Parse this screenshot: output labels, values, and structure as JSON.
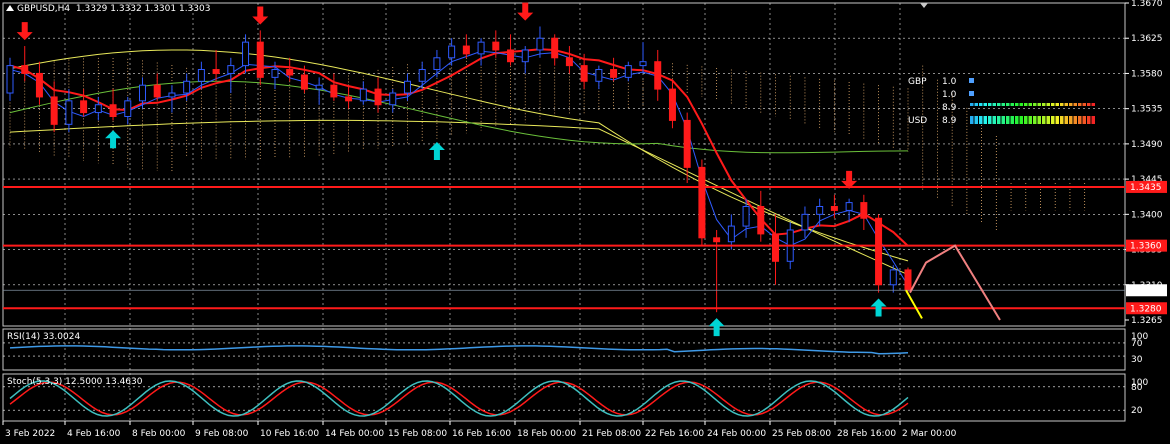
{
  "header": {
    "symbol": "GBPUSD,H4",
    "ohlc": "1.3329 1.3332 1.3301 1.3303"
  },
  "price_axis": {
    "ticks": [
      "1.3670",
      "1.3625",
      "1.3580",
      "1.3535",
      "1.3490",
      "1.3445",
      "1.3400",
      "1.3355",
      "1.3310",
      "1.3265"
    ],
    "ymax": 1.367,
    "ymin": 1.3265
  },
  "levels": [
    {
      "price": 1.3435,
      "label": "1.3435",
      "color": "#ff1a1a"
    },
    {
      "price": 1.336,
      "label": "1.3360",
      "color": "#ff1a1a"
    },
    {
      "price": 1.328,
      "label": "1.3280",
      "color": "#ff1a1a"
    }
  ],
  "current_price": {
    "price": 1.3303,
    "label": "1.3303"
  },
  "time_axis": [
    "3 Feb 2022",
    "4 Feb 16:00",
    "8 Feb 00:00",
    "9 Feb 08:00",
    "10 Feb 16:00",
    "14 Feb 00:00",
    "15 Feb 08:00",
    "16 Feb 16:00",
    "18 Feb 00:00",
    "21 Feb 08:00",
    "22 Feb 16:00",
    "24 Feb 00:00",
    "25 Feb 08:00",
    "28 Feb 16:00",
    "2 Mar 00:00"
  ],
  "strength_panel": {
    "rows": [
      {
        "name": "GBP",
        "value": "1.0",
        "value_color": "#ffa500",
        "name_color": "#00ff00"
      },
      {
        "name": "",
        "value": "1.0",
        "value_color": "#4fa0ff",
        "name_color": "#00ff00"
      },
      {
        "name": "",
        "value": "8.9",
        "value_color": "#ffa500",
        "name_color": "#00ff00"
      },
      {
        "name": "USD",
        "value": "8.9",
        "value_color": "#4fa0ff",
        "name_color": "#00ff00"
      }
    ]
  },
  "rsi": {
    "label": "RSI(14) 33.0024",
    "levels": [
      "70",
      "30"
    ],
    "scale_top": "100",
    "scale_bottom": "0"
  },
  "stoch": {
    "label": "Stoch(5,3,3) 12.5000 13.4630",
    "levels": [
      "80",
      "20"
    ],
    "scale_top": "100",
    "scale_bottom": "0"
  },
  "colors": {
    "bull": "#2f5bff",
    "bear": "#ff1a1a",
    "grid": "#ffffff",
    "level": "#ff1a1a",
    "arrow_up": "#00d4d4",
    "arrow_down": "#ff1a1a",
    "ma_fast": "#ff1a1a",
    "ma_slow": "#e8e85a",
    "ma_green": "#6abf3a",
    "rsi_line": "#3f9ae8",
    "stoch_main": "#3fbfbf",
    "stoch_signal": "#ff1a1a"
  },
  "chart_data": {
    "type": "candlestick",
    "title": "GBPUSD,H4",
    "ylim": [
      1.3265,
      1.367
    ],
    "candles": [
      [
        1.3555,
        1.36,
        1.3545,
        1.359
      ],
      [
        1.359,
        1.3615,
        1.357,
        1.358
      ],
      [
        1.358,
        1.3595,
        1.354,
        1.355
      ],
      [
        1.355,
        1.357,
        1.3505,
        1.3515
      ],
      [
        1.3515,
        1.356,
        1.3505,
        1.3545
      ],
      [
        1.3545,
        1.356,
        1.3525,
        1.353
      ],
      [
        1.353,
        1.355,
        1.352,
        1.354
      ],
      [
        1.354,
        1.356,
        1.352,
        1.3525
      ],
      [
        1.3525,
        1.355,
        1.3515,
        1.3545
      ],
      [
        1.3545,
        1.3575,
        1.3535,
        1.3565
      ],
      [
        1.3565,
        1.358,
        1.3545,
        1.355
      ],
      [
        1.355,
        1.3565,
        1.353,
        1.3555
      ],
      [
        1.3555,
        1.358,
        1.3545,
        1.357
      ],
      [
        1.357,
        1.3595,
        1.356,
        1.3585
      ],
      [
        1.3585,
        1.361,
        1.357,
        1.358
      ],
      [
        1.358,
        1.36,
        1.3555,
        1.359
      ],
      [
        1.359,
        1.363,
        1.358,
        1.362
      ],
      [
        1.362,
        1.3635,
        1.3565,
        1.3575
      ],
      [
        1.3575,
        1.3595,
        1.356,
        1.3585
      ],
      [
        1.3585,
        1.36,
        1.357,
        1.3578
      ],
      [
        1.3578,
        1.359,
        1.3555,
        1.356
      ],
      [
        1.356,
        1.3575,
        1.354,
        1.3565
      ],
      [
        1.3565,
        1.358,
        1.3545,
        1.355
      ],
      [
        1.355,
        1.3565,
        1.3535,
        1.3545
      ],
      [
        1.3545,
        1.357,
        1.354,
        1.356
      ],
      [
        1.356,
        1.3575,
        1.353,
        1.354
      ],
      [
        1.354,
        1.356,
        1.353,
        1.3555
      ],
      [
        1.3555,
        1.358,
        1.3545,
        1.357
      ],
      [
        1.357,
        1.3595,
        1.356,
        1.3585
      ],
      [
        1.3585,
        1.361,
        1.3575,
        1.36
      ],
      [
        1.36,
        1.3625,
        1.359,
        1.3615
      ],
      [
        1.3615,
        1.363,
        1.36,
        1.3605
      ],
      [
        1.3605,
        1.3625,
        1.359,
        1.362
      ],
      [
        1.362,
        1.3635,
        1.36,
        1.361
      ],
      [
        1.361,
        1.363,
        1.359,
        1.3595
      ],
      [
        1.3595,
        1.3615,
        1.358,
        1.361
      ],
      [
        1.361,
        1.364,
        1.36,
        1.3625
      ],
      [
        1.3625,
        1.363,
        1.359,
        1.36
      ],
      [
        1.36,
        1.3615,
        1.358,
        1.359
      ],
      [
        1.359,
        1.3605,
        1.356,
        1.357
      ],
      [
        1.357,
        1.359,
        1.356,
        1.3585
      ],
      [
        1.3585,
        1.36,
        1.357,
        1.3575
      ],
      [
        1.3575,
        1.3595,
        1.357,
        1.359
      ],
      [
        1.359,
        1.362,
        1.358,
        1.3595
      ],
      [
        1.3595,
        1.361,
        1.3545,
        1.356
      ],
      [
        1.356,
        1.357,
        1.351,
        1.352
      ],
      [
        1.352,
        1.353,
        1.344,
        1.346
      ],
      [
        1.346,
        1.347,
        1.336,
        1.337
      ],
      [
        1.337,
        1.338,
        1.3275,
        1.3365
      ],
      [
        1.3365,
        1.34,
        1.3355,
        1.3385
      ],
      [
        1.3385,
        1.342,
        1.337,
        1.341
      ],
      [
        1.341,
        1.343,
        1.3365,
        1.3375
      ],
      [
        1.3375,
        1.34,
        1.331,
        1.334
      ],
      [
        1.334,
        1.339,
        1.333,
        1.338
      ],
      [
        1.338,
        1.341,
        1.337,
        1.34
      ],
      [
        1.34,
        1.342,
        1.3385,
        1.341
      ],
      [
        1.341,
        1.3425,
        1.3395,
        1.3405
      ],
      [
        1.3405,
        1.342,
        1.339,
        1.3415
      ],
      [
        1.3415,
        1.3425,
        1.338,
        1.3395
      ],
      [
        1.3395,
        1.34,
        1.33,
        1.331
      ],
      [
        1.331,
        1.3335,
        1.33,
        1.3329
      ],
      [
        1.3329,
        1.3332,
        1.3301,
        1.3303
      ]
    ],
    "arrows_up": [
      {
        "i": 7,
        "p": 1.351
      },
      {
        "i": 29,
        "p": 1.3495
      },
      {
        "i": 48,
        "p": 1.327
      },
      {
        "i": 59,
        "p": 1.3295
      }
    ],
    "arrows_down": [
      {
        "i": 1,
        "p": 1.362
      },
      {
        "i": 17,
        "p": 1.364
      },
      {
        "i": 35,
        "p": 1.3645
      },
      {
        "i": 57,
        "p": 1.343
      }
    ],
    "projection_red": [
      [
        1.3303,
        1.3265
      ],
      [
        1.3305,
        1.336
      ],
      [
        1.336,
        1.3265
      ]
    ],
    "projection_yellow": [
      1.3303,
      1.3265
    ]
  }
}
